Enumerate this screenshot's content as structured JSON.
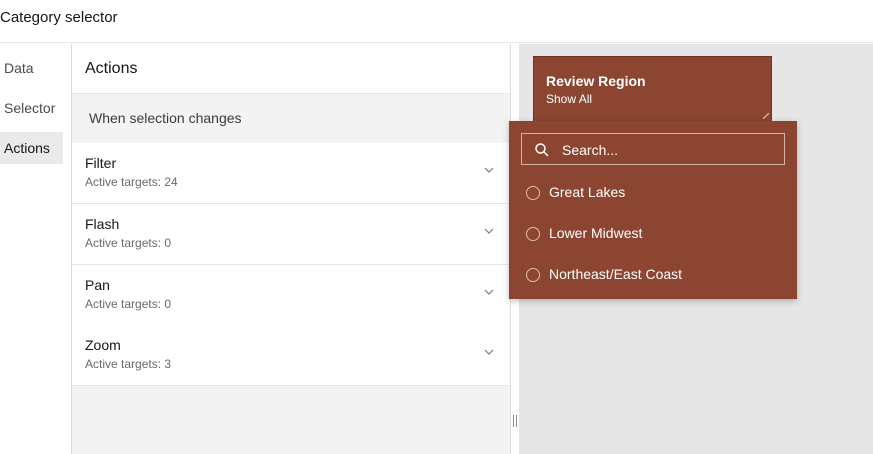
{
  "app": {
    "title": "Category selector"
  },
  "nav": {
    "items": [
      {
        "label": "Data"
      },
      {
        "label": "Selector"
      },
      {
        "label": "Actions"
      }
    ]
  },
  "panel": {
    "title": "Actions",
    "section_label": "When selection changes",
    "actions": [
      {
        "name": "Filter",
        "sub": "Active targets: 24"
      },
      {
        "name": "Flash",
        "sub": "Active targets: 0"
      },
      {
        "name": "Pan",
        "sub": "Active targets: 0"
      },
      {
        "name": "Zoom",
        "sub": "Active targets: 3"
      }
    ]
  },
  "widget": {
    "title": "Review Region",
    "subtitle": "Show All"
  },
  "dropdown": {
    "search_placeholder": "Search...",
    "options": [
      {
        "label": "Great Lakes"
      },
      {
        "label": "Lower Midwest"
      },
      {
        "label": "Northeast/East Coast"
      }
    ]
  },
  "colors": {
    "accent": "#8b4530",
    "canvas": "#e6e6e6",
    "panel_bg": "#f3f3f3"
  }
}
